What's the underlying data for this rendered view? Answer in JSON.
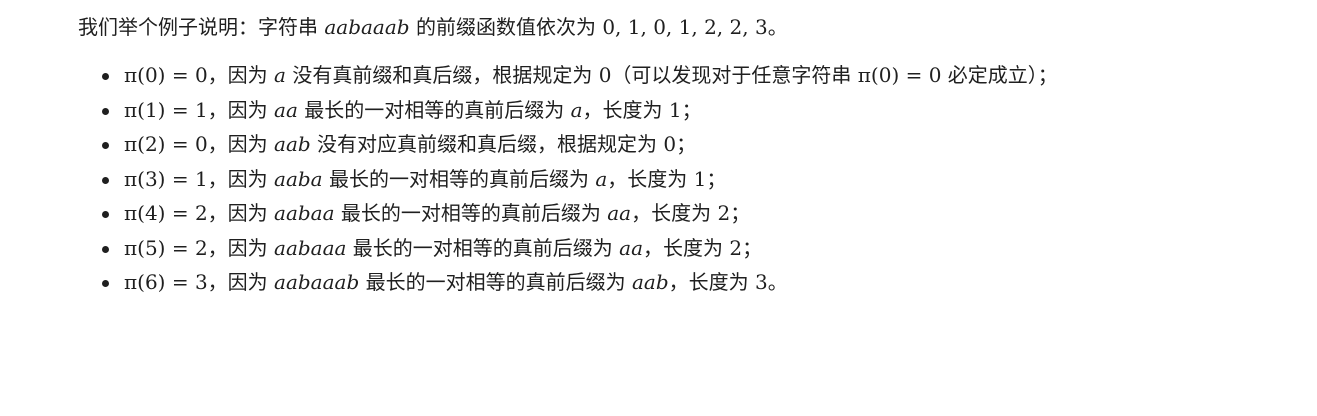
{
  "intro": {
    "prefix": "我们举个例子说明：字符串 ",
    "string": "aabaaab",
    "middle": " 的前缀函数值依次为 ",
    "values": "0, 1, 0, 1, 2, 2, 3",
    "suffix": "。"
  },
  "items": [
    {
      "eq": "π(0) = 0",
      "pre": "，因为 ",
      "var": "a",
      "post": " 没有真前缀和真后缀，根据规定为 ",
      "num": "0",
      "tail_pre": "（可以发现对于任意字符串 ",
      "tail_eq": "π(0) = 0",
      "tail_post": " 必定成立）；"
    },
    {
      "eq": "π(1) = 1",
      "pre": "，因为 ",
      "var": "aa",
      "post": " 最长的一对相等的真前后缀为 ",
      "var2": "a",
      "post2": "，长度为 ",
      "num": "1",
      "end": "；"
    },
    {
      "eq": "π(2) = 0",
      "pre": "，因为 ",
      "var": "aab",
      "post": " 没有对应真前缀和真后缀，根据规定为 ",
      "num": "0",
      "end": "；"
    },
    {
      "eq": "π(3) = 1",
      "pre": "，因为 ",
      "var": "aaba",
      "post": " 最长的一对相等的真前后缀为 ",
      "var2": "a",
      "post2": "，长度为 ",
      "num": "1",
      "end": "；"
    },
    {
      "eq": "π(4) = 2",
      "pre": "，因为 ",
      "var": "aabaa",
      "post": " 最长的一对相等的真前后缀为 ",
      "var2": "aa",
      "post2": "，长度为 ",
      "num": "2",
      "end": "；"
    },
    {
      "eq": "π(5) = 2",
      "pre": "，因为 ",
      "var": "aabaaa",
      "post": " 最长的一对相等的真前后缀为 ",
      "var2": "aa",
      "post2": "，长度为 ",
      "num": "2",
      "end": "；"
    },
    {
      "eq": "π(6) = 3",
      "pre": "，因为 ",
      "var": "aabaaab",
      "post": " 最长的一对相等的真前后缀为 ",
      "var2": "aab",
      "post2": "，长度为 ",
      "num": "3",
      "end": "。"
    }
  ]
}
